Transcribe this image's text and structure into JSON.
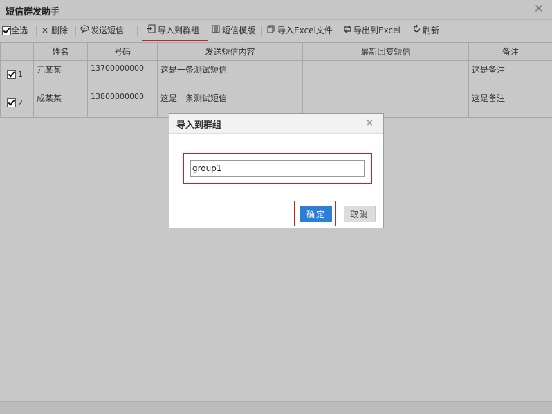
{
  "window": {
    "title": "短信群发助手",
    "close_glyph": "✕"
  },
  "toolbar": {
    "select_all": "全选",
    "delete": "删除",
    "send_sms": "发送短信",
    "import_group": "导入到群组",
    "sms_template": "短信模版",
    "import_excel": "导入Excel文件",
    "export_excel": "导出到Excel",
    "refresh": "刷新"
  },
  "table": {
    "columns": [
      "姓名",
      "号码",
      "发送短信内容",
      "最新回复短信",
      "备注"
    ],
    "rows": [
      {
        "index": "1",
        "checked": true,
        "name": "元某某",
        "phone": "13700000000",
        "content": "这是一条测试短信",
        "reply": "",
        "note": "这是备注"
      },
      {
        "index": "2",
        "checked": true,
        "name": "成某某",
        "phone": "13800000000",
        "content": "这是一条测试短信",
        "reply": "",
        "note": "这是备注"
      }
    ]
  },
  "dialog": {
    "title": "导入到群组",
    "close_glyph": "✕",
    "input_value": "group1",
    "confirm": "确定",
    "cancel": "取消"
  },
  "colors": {
    "highlight": "#d21e1e",
    "primary_button": "#2b7fd4"
  }
}
